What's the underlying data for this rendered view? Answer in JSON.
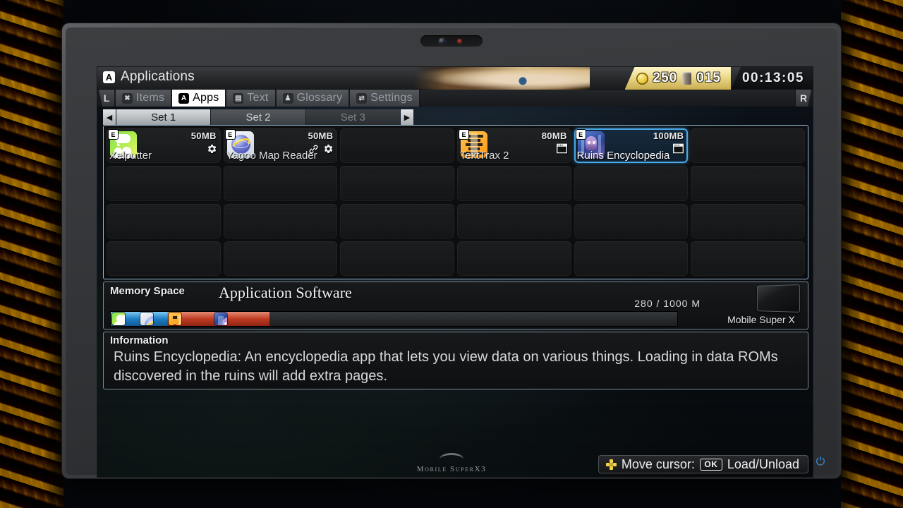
{
  "header": {
    "badge": "A",
    "title": "Applications",
    "gold_icon": "coin-icon",
    "gold": "250",
    "capsule_icon": "capsule-icon",
    "capsules": "015",
    "time": "00:13:05"
  },
  "shoulders": {
    "left": "L",
    "right": "R"
  },
  "tabs": [
    {
      "badge": "✖",
      "label": "Items",
      "active": false
    },
    {
      "badge": "A",
      "label": "Apps",
      "active": true
    },
    {
      "badge": "▤",
      "label": "Text",
      "active": false
    },
    {
      "badge": "♟",
      "label": "Glossary",
      "active": false
    },
    {
      "badge": "⇄",
      "label": "Settings",
      "active": false
    }
  ],
  "sets": {
    "prev_arrow": "◀",
    "next_arrow": "▶",
    "items": [
      {
        "label": "Set 1",
        "active": true,
        "locked": false
      },
      {
        "label": "Set 2",
        "active": false,
        "locked": false
      },
      {
        "label": "Set 3",
        "active": false,
        "locked": true
      }
    ]
  },
  "grid": {
    "columns": 6,
    "rows": 4,
    "apps": [
      {
        "slot": 0,
        "name": "Xelputter",
        "size": "50MB",
        "rating": "E",
        "icon": "xelputter-icon",
        "art": "ico-xel",
        "flags": [
          "gear-icon"
        ],
        "selected": false
      },
      {
        "slot": 1,
        "name": "Yagoo Map Reader",
        "size": "50MB",
        "rating": "E",
        "icon": "yagoo-map-reader-icon",
        "art": "ico-yagoo",
        "flags": [
          "link-icon",
          "gear-icon"
        ],
        "selected": false
      },
      {
        "slot": 3,
        "name": "TextTrax 2",
        "size": "80MB",
        "rating": "E",
        "icon": "texttrax-2-icon",
        "art": "ico-tt",
        "flags": [
          "window-icon"
        ],
        "selected": false
      },
      {
        "slot": 4,
        "name": "Ruins Encyclopedia",
        "size": "100MB",
        "rating": "E",
        "icon": "ruins-encyclopedia-icon",
        "art": "ico-ruins",
        "flags": [
          "window-icon"
        ],
        "selected": true
      }
    ]
  },
  "memory": {
    "label": "Memory Space",
    "kind": "Application Software",
    "capacity_text": "280 / 1000 M",
    "used": 280,
    "total": 1000,
    "segments": [
      {
        "app": "Xelputter",
        "size": 50,
        "state": "loaded",
        "color": "#1d7ec4",
        "art": "ico-xel"
      },
      {
        "app": "Yagoo Map Reader",
        "size": 50,
        "state": "loaded",
        "color": "#1d7ec4",
        "art": "ico-yagoo"
      },
      {
        "app": "TextTrax 2",
        "size": 80,
        "state": "unloaded",
        "color": "#c03b22",
        "art": "ico-tt"
      },
      {
        "app": "Ruins Encyclopedia",
        "size": 100,
        "state": "unloaded",
        "color": "#c03b22",
        "art": "ico-ruins"
      }
    ],
    "device_name": "Mobile Super X"
  },
  "information": {
    "label": "Information",
    "text": "Ruins Encyclopedia: An encyclopedia app that lets you view data on various things. Loading in data ROMs discovered in the ruins will add extra pages."
  },
  "hints": {
    "dpad_icon": "dpad-icon",
    "move_label": "Move cursor:",
    "ok_key": "OK",
    "ok_label": "Load/Unload"
  },
  "device": {
    "brand": "Mobile SuperX3",
    "power_icon": "power-icon"
  },
  "colors": {
    "accent_blue": "#4aa8e8",
    "gold": "#ecd98b",
    "panel_border": "#7f8a93",
    "grid_border": "#98b7cf",
    "loaded": "#1d7ec4",
    "unloaded": "#c03b22"
  }
}
